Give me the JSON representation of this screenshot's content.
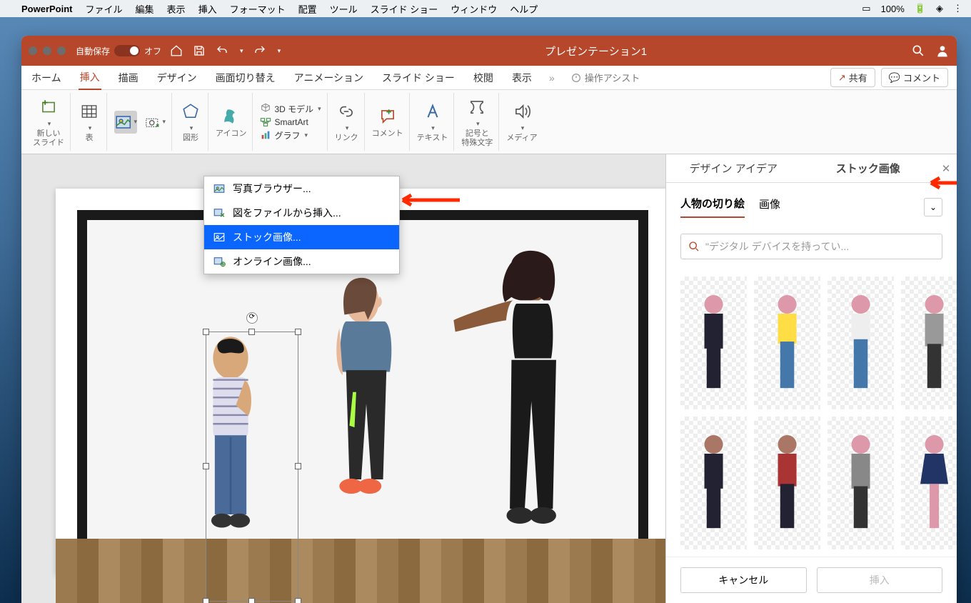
{
  "mac_menu": {
    "app": "PowerPoint",
    "items": [
      "ファイル",
      "編集",
      "表示",
      "挿入",
      "フォーマット",
      "配置",
      "ツール",
      "スライド ショー",
      "ウィンドウ",
      "ヘルプ"
    ],
    "battery": "100%"
  },
  "titlebar": {
    "autosave_label": "自動保存",
    "autosave_state": "オフ",
    "doc_title": "プレゼンテーション1"
  },
  "ribbon_tabs": [
    "ホーム",
    "挿入",
    "描画",
    "デザイン",
    "画面切り替え",
    "アニメーション",
    "スライド ショー",
    "校閲",
    "表示"
  ],
  "ribbon_active": "挿入",
  "assist": "操作アシスト",
  "share": "共有",
  "comment": "コメント",
  "ribbon_groups": {
    "new_slide": "新しい\nスライド",
    "table": "表",
    "shapes": "図形",
    "icons": "アイコン",
    "model3d": "3D モデル",
    "smartart": "SmartArt",
    "chart": "グラフ",
    "link": "リンク",
    "comment": "コメント",
    "text": "テキスト",
    "symbols": "記号と\n特殊文字",
    "media": "メディア"
  },
  "dropdown_items": [
    "写真ブラウザー...",
    "図をファイルから挿入...",
    "ストック画像...",
    "オンライン画像..."
  ],
  "dropdown_highlight_index": 2,
  "side_panel": {
    "tabs": [
      "デザイン アイデア",
      "ストック画像"
    ],
    "active_tab": "ストック画像",
    "categories": [
      "人物の切り絵",
      "画像"
    ],
    "active_category": "人物の切り絵",
    "search_placeholder": "\"デジタル デバイスを持ってい...",
    "cancel": "キャンセル",
    "insert": "挿入"
  }
}
